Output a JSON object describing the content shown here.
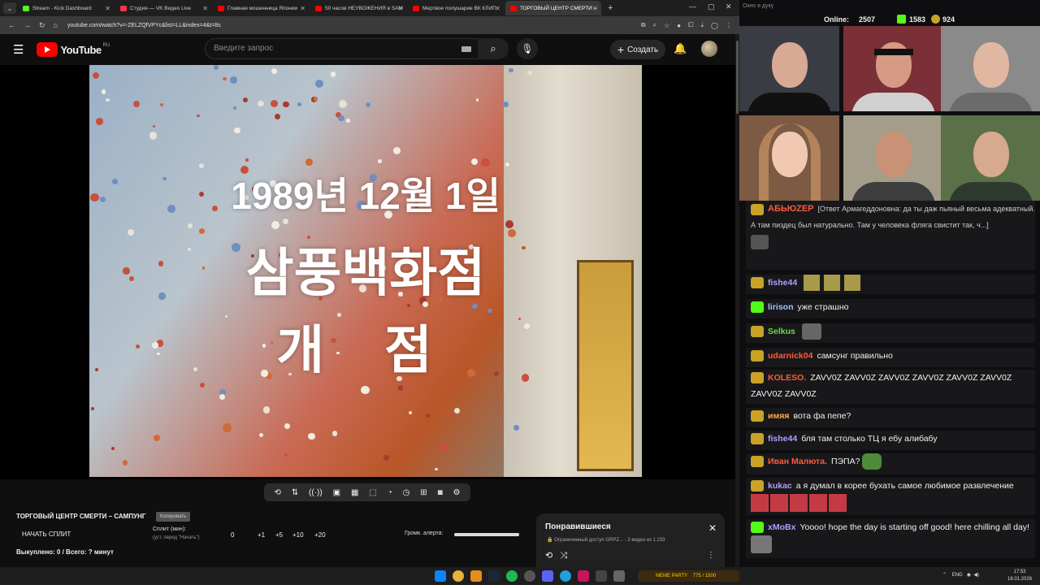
{
  "browser": {
    "tabs": [
      {
        "title": "Stream - Kick Dashboard",
        "color": "#53fc18"
      },
      {
        "title": "Студия — VK Видео Live",
        "color": "#ff3347"
      },
      {
        "title": "Главная мошенница Японии",
        "color": "#ff0000"
      },
      {
        "title": "50 часов НЕУВОЖЕНИЯ в SAM",
        "color": "#ff0000"
      },
      {
        "title": "Мертвое полушарие ВК КЛИП",
        "color": "#ff0000"
      },
      {
        "title": "ТОРГОВЫЙ ЦЕНТР СМЕРТИ – ",
        "color": "#ff0000"
      }
    ],
    "url": "youtube.com/watch?v=-ZELZQfVPYc&list=LL&index=4&t=8s"
  },
  "youtube": {
    "logo_text": "YouTube",
    "region": "RU",
    "search_placeholder": "Введите запрос",
    "create_label": "Создать"
  },
  "video": {
    "line1": "1989년 12월 1일",
    "line2": "삼풍백화점",
    "line3": "개 점"
  },
  "extension": {
    "title": "ТОРГОВЫЙ ЦЕНТР СМЕРТИ – САМПУНГ",
    "copy_label": "Копировать",
    "start_split": "НАЧАТЬ СПЛИТ",
    "split_label": "Сплит (мин):",
    "split_note": "(уст. перед \"Начать\")",
    "counter": "0",
    "increments": [
      "+1",
      "+5",
      "+10",
      "+20"
    ],
    "alert_label": "Громк. алерта:",
    "alert_level": 1.0,
    "bought": "Выкуплено: 0 / Всего: ? минут"
  },
  "playlist": {
    "title": "Понравившиеся",
    "access": "Ограниченный доступ",
    "owner": "GRPZ...",
    "count": "- 3 видео из 1 233"
  },
  "stream": {
    "window_title": "Окно в дуку",
    "online_label": "Online:",
    "online_count": "2507",
    "kick_count": "1583",
    "other_count": "924"
  },
  "chat": [
    {
      "user": "АБЬЮZЕР",
      "color": "#ff5a3c",
      "text": "[Ответ Армагеддоновна: да ты даж пьяный весьма адекватный. А там пиздец был натурально. Там у человека фляга свистит так, ч...]"
    },
    {
      "user": "fishe44",
      "color": "#b59cff",
      "text": ""
    },
    {
      "user": "lirison",
      "color": "#9ec6ff",
      "text": "уже страшно"
    },
    {
      "user": "Selkus",
      "color": "#6fd94a",
      "text": ""
    },
    {
      "user": "udarnick04",
      "color": "#ff5a3c",
      "text": "самсунг правильно"
    },
    {
      "user": "KOLESO.",
      "color": "#ff5a3c",
      "text": "ZAVV0Z ZAVV0Z ZAVV0Z ZAVV0Z ZAVV0Z ZAVV0Z ZAVV0Z ZAVV0Z"
    },
    {
      "user": "имяя",
      "color": "#ffa940",
      "text": "вота фа пепе?"
    },
    {
      "user": "fishe44",
      "color": "#b59cff",
      "text": "бля там столько ТЦ я ебу алибабу"
    },
    {
      "user": "Иван Малюта.",
      "color": "#ff5a3c",
      "text": "ПЭПА?"
    },
    {
      "user": "kukac",
      "color": "#b59cff",
      "text": "а я думал в корее бухать самое любимое развлечение"
    },
    {
      "user": "xMoBx",
      "color": "#b59cff",
      "text": "Yoooo! hope the day is starting off good! here chilling all day!"
    }
  ],
  "taskbar": {
    "meme_label": "MEME PARTY",
    "meme_count": "775 / 1500",
    "lang": "ENG",
    "time": "17:53",
    "date": "18.01.2026"
  }
}
